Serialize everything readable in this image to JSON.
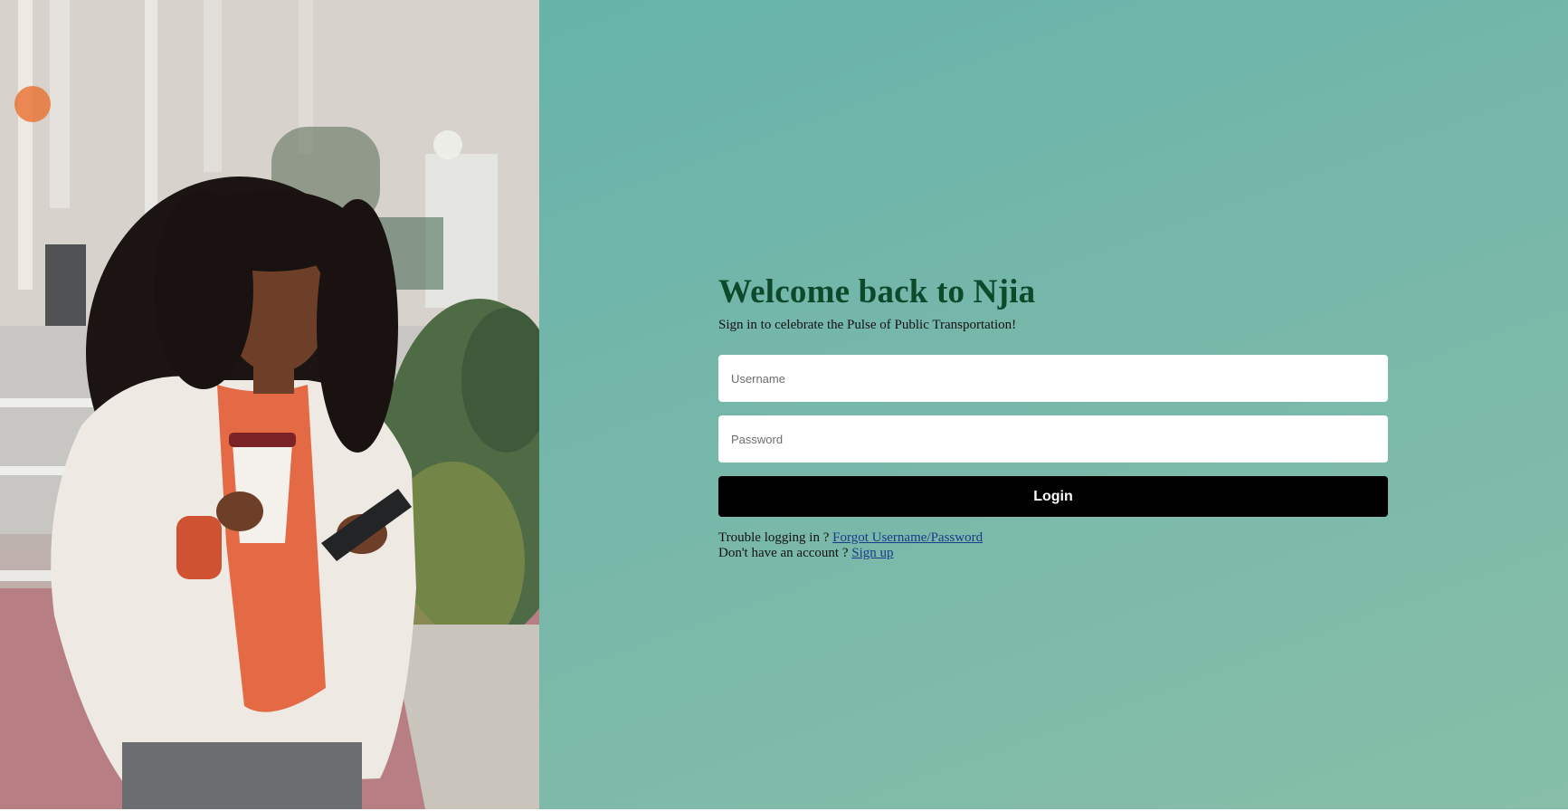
{
  "hero": {
    "image_subject": "woman with curly hair holding coffee cup and smartphone on city street"
  },
  "login": {
    "title": "Welcome back to Njia",
    "subtitle": "Sign in to celebrate the Pulse of Public Transportation!",
    "username_placeholder": "Username",
    "password_placeholder": "Password",
    "login_button_label": "Login",
    "trouble_text": "Trouble logging in ? ",
    "forgot_link_label": "Forgot Username/Password",
    "no_account_text": "Don't have an account ? ",
    "signup_link_label": "Sign up"
  },
  "colors": {
    "title": "#0d4a2c",
    "panel_gradient_start": "#66b3aa",
    "panel_gradient_end": "#86bea8",
    "button_bg": "#000000",
    "link": "#1a3a8a"
  }
}
